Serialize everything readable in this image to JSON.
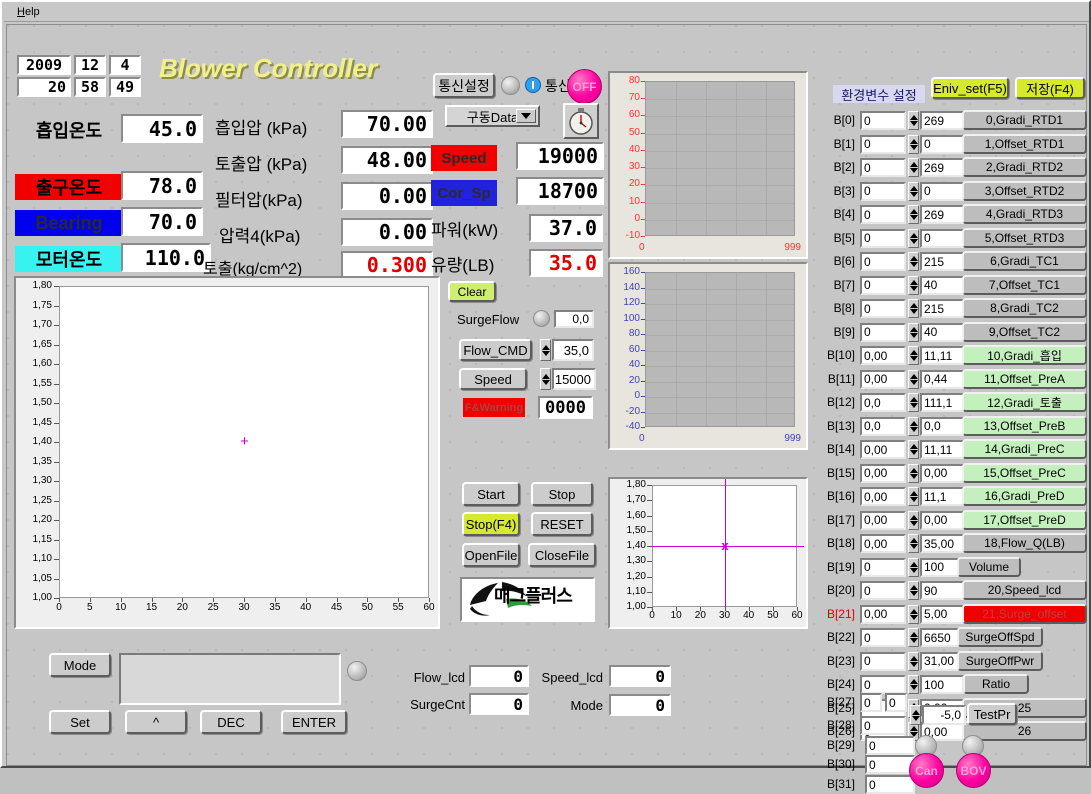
{
  "window": {
    "menu": [
      {
        "label": "Help"
      }
    ]
  },
  "header": {
    "title": "Blower Controller",
    "date": {
      "year": "2009",
      "month": "12",
      "day": "4"
    },
    "time": {
      "hour": "20",
      "min": "58",
      "sec": "49"
    }
  },
  "comm": {
    "setup_button": "통신설정",
    "label": "통신",
    "status": "OFF",
    "combo_value": "구동Data",
    "led_icon": "status-led",
    "power_icon": "power-icon",
    "clock_icon": "stopwatch-icon"
  },
  "measurements_left": [
    {
      "tag": "흡입온도",
      "value": "45.0",
      "tag_bg": "none",
      "value_color": "black"
    },
    {
      "tag": "출구온도",
      "value": "78.0",
      "tag_bg": "#f20000",
      "value_color": "black"
    },
    {
      "tag": "Bearing",
      "value": "70.0",
      "tag_bg": "#0000ee",
      "value_color": "black"
    },
    {
      "tag": "모터온도",
      "value": "110.0",
      "tag_bg": "#38f2f2",
      "value_color": "black"
    }
  ],
  "measurements_mid": [
    {
      "tag": "흡입압 (kPa)",
      "value": "70.00",
      "value_color": "black"
    },
    {
      "tag": "토출압 (kPa)",
      "value": "48.00",
      "value_color": "black"
    },
    {
      "tag": "필터압(kPa)",
      "value": "0.00",
      "value_color": "black"
    },
    {
      "tag": "압력4(kPa)",
      "value": "0.00",
      "value_color": "black"
    },
    {
      "tag": "토출(kg/cm^2)",
      "value": "0.300",
      "value_color": "red"
    }
  ],
  "measurements_right": [
    {
      "tag": "Speed",
      "value": "19000",
      "tag_bg": "#f20000",
      "value_color": "black"
    },
    {
      "tag": "Cor_Sp",
      "value": "18700",
      "tag_bg": "#2222dd",
      "value_color": "black"
    },
    {
      "tag": "파워(kW)",
      "value": "37.0",
      "tag_bg": "none",
      "value_color": "black"
    },
    {
      "tag": "유량(LB)",
      "value": "35.0",
      "tag_bg": "none",
      "value_color": "red"
    }
  ],
  "control_panel": {
    "clear_button": "Clear",
    "surgeflow_label": "SurgeFlow",
    "surgeflow_value": "0,0",
    "flow_cmd_button": "Flow_CMD",
    "flow_cmd_value": "35,0",
    "speed_button": "Speed",
    "speed_value": "15000",
    "fwarning_label": "F&Warning",
    "fwarning_value": "0000",
    "start_button": "Start",
    "stop_button": "Stop",
    "stop_f4_button": "Stop(F4)",
    "reset_button": "RESET",
    "openfile_button": "OpenFile",
    "closefile_button": "CloseFile",
    "logo_text": "매그플러스"
  },
  "bottom_panel": {
    "mode_button": "Mode",
    "display_value": "",
    "set_button": "Set",
    "up_button": "^",
    "dec_button": "DEC",
    "enter_button": "ENTER",
    "indicators": [
      {
        "label": "Flow_lcd",
        "value": "0"
      },
      {
        "label": "SurgeCnt",
        "value": "0"
      },
      {
        "label": "Speed_lcd",
        "value": "0"
      },
      {
        "label": "Mode",
        "value": "0"
      }
    ]
  },
  "env_panel": {
    "title": "환경변수 설정",
    "env_set_button": "Eniv_set(F5)",
    "save_button": "저장(F4)",
    "rows": [
      {
        "idx": "B[0]",
        "v1": "0",
        "v2": "269",
        "name": "0,Gradi_RTD1",
        "style": "grey"
      },
      {
        "idx": "B[1]",
        "v1": "0",
        "v2": "0",
        "name": "1,Offset_RTD1",
        "style": "grey"
      },
      {
        "idx": "B[2]",
        "v1": "0",
        "v2": "269",
        "name": "2,Gradi_RTD2",
        "style": "grey"
      },
      {
        "idx": "B[3]",
        "v1": "0",
        "v2": "0",
        "name": "3,Offset_RTD2",
        "style": "grey"
      },
      {
        "idx": "B[4]",
        "v1": "0",
        "v2": "269",
        "name": "4,Gradi_RTD3",
        "style": "grey"
      },
      {
        "idx": "B[5]",
        "v1": "0",
        "v2": "0",
        "name": "5,Offset_RTD3",
        "style": "grey"
      },
      {
        "idx": "B[6]",
        "v1": "0",
        "v2": "215",
        "name": "6,Gradi_TC1",
        "style": "grey"
      },
      {
        "idx": "B[7]",
        "v1": "0",
        "v2": "40",
        "name": "7,Offset_TC1",
        "style": "grey"
      },
      {
        "idx": "B[8]",
        "v1": "0",
        "v2": "215",
        "name": "8,Gradi_TC2",
        "style": "grey"
      },
      {
        "idx": "B[9]",
        "v1": "0",
        "v2": "40",
        "name": "9,Offset_TC2",
        "style": "grey"
      },
      {
        "idx": "B[10]",
        "v1": "0,00",
        "v2": "11,11",
        "name": "10,Gradi_흡입",
        "style": "green"
      },
      {
        "idx": "B[11]",
        "v1": "0,00",
        "v2": "0,44",
        "name": "11,Offset_PreA",
        "style": "green"
      },
      {
        "idx": "B[12]",
        "v1": "0,0",
        "v2": "111,1",
        "name": "12,Gradi_토출",
        "style": "green"
      },
      {
        "idx": "B[13]",
        "v1": "0,0",
        "v2": "0,0",
        "name": "13,Offset_PreB",
        "style": "green"
      },
      {
        "idx": "B[14]",
        "v1": "0,00",
        "v2": "11,11",
        "name": "14,Gradi_PreC",
        "style": "green"
      },
      {
        "idx": "B[15]",
        "v1": "0,00",
        "v2": "0,00",
        "name": "15,Offset_PreC",
        "style": "green"
      },
      {
        "idx": "B[16]",
        "v1": "0,00",
        "v2": "11,1",
        "name": "16,Gradi_PreD",
        "style": "green"
      },
      {
        "idx": "B[17]",
        "v1": "0,00",
        "v2": "0,00",
        "name": "17,Offset_PreD",
        "style": "green"
      },
      {
        "idx": "B[18]",
        "v1": "0,00",
        "v2": "35,00",
        "name": "18,Flow_Q(LB)",
        "style": "grey"
      },
      {
        "idx": "B[19]",
        "v1": "0",
        "v2": "100",
        "name": "Volume",
        "style": "grey"
      },
      {
        "idx": "B[20]",
        "v1": "0",
        "v2": "90",
        "name": "20,Speed_lcd",
        "style": "grey"
      },
      {
        "idx": "B[21]",
        "v1": "0,00",
        "v2": "5,00",
        "name": "21,Surge_offset",
        "style": "red"
      },
      {
        "idx": "B[22]",
        "v1": "0",
        "v2": "6650",
        "name": "SurgeOffSpd",
        "style": "grey"
      },
      {
        "idx": "B[23]",
        "v1": "0",
        "v2": "31,00",
        "name": "SurgeOffPwr",
        "style": "grey"
      },
      {
        "idx": "B[24]",
        "v1": "0",
        "v2": "100",
        "name": "Ratio",
        "style": "grey"
      },
      {
        "idx": "B[25]",
        "v1": "0",
        "v2": "0,00",
        "name": "25",
        "style": "grey"
      },
      {
        "idx": "B[26]",
        "v1": "0",
        "v2": "0,00",
        "name": "26",
        "style": "grey"
      }
    ],
    "tail_rows": [
      {
        "idx": "B[27]",
        "v1": "0",
        "v2": "0"
      },
      {
        "idx": "B[28]",
        "v1": "0"
      },
      {
        "idx": "B[29]",
        "v1": "0"
      },
      {
        "idx": "B[30]",
        "v1": "0"
      },
      {
        "idx": "B[31]",
        "v1": "0"
      }
    ],
    "testpr_value": "-5,0",
    "testpr_button": "TestPr",
    "can_button": "Can",
    "bov_button": "BOV"
  },
  "chart_data": [
    {
      "type": "line",
      "name": "main-chart",
      "title": "",
      "xlabel": "",
      "ylabel": "",
      "x_ticks": [
        0,
        5,
        10,
        15,
        20,
        25,
        30,
        35,
        40,
        45,
        50,
        55,
        60
      ],
      "y_ticks": [
        "1,00",
        "1,05",
        "1,10",
        "1,15",
        "1,20",
        "1,25",
        "1,30",
        "1,35",
        "1,40",
        "1,45",
        "1,50",
        "1,55",
        "1,60",
        "1,65",
        "1,70",
        "1,75",
        "1,80"
      ],
      "xlim": [
        0,
        60
      ],
      "ylim": [
        1.0,
        1.8
      ],
      "grid": false,
      "series": [],
      "cursor": {
        "x": 30,
        "y": 1.4,
        "color": "#cc00cc"
      },
      "plot_bg": "#ffffff"
    },
    {
      "type": "line",
      "name": "temperature-trend",
      "title": "",
      "xlabel": "",
      "ylabel": "",
      "x_ticks": [
        "0",
        "999"
      ],
      "y_ticks": [
        "-10",
        "0",
        "10",
        "20",
        "30",
        "40",
        "50",
        "60",
        "70",
        "80"
      ],
      "xlim": [
        0,
        999
      ],
      "ylim": [
        -10,
        80
      ],
      "grid": true,
      "tick_color": "#ff3030",
      "series": [],
      "plot_bg": "#b8b8b8"
    },
    {
      "type": "line",
      "name": "pressure-trend",
      "title": "",
      "xlabel": "",
      "ylabel": "",
      "x_ticks": [
        "0",
        "999"
      ],
      "y_ticks": [
        "-40",
        "-20",
        "0",
        "20",
        "40",
        "60",
        "80",
        "100",
        "120",
        "140",
        "160"
      ],
      "xlim": [
        0,
        999
      ],
      "ylim": [
        -40,
        160
      ],
      "grid": true,
      "tick_color": "#4040c0",
      "series": [],
      "plot_bg": "#b8b8b8"
    },
    {
      "type": "line",
      "name": "surge-map",
      "title": "",
      "xlabel": "",
      "ylabel": "",
      "x_ticks": [
        0,
        10,
        20,
        30,
        40,
        50,
        60
      ],
      "y_ticks": [
        "1,00",
        "1,10",
        "1,20",
        "1,30",
        "1,40",
        "1,50",
        "1,60",
        "1,70",
        "1,80"
      ],
      "xlim": [
        0,
        60
      ],
      "ylim": [
        1.0,
        1.8
      ],
      "grid": false,
      "series": [],
      "cursor": {
        "x": 30,
        "y": 1.4,
        "color": "#cc00cc"
      },
      "plot_bg": "#ffffff"
    }
  ]
}
